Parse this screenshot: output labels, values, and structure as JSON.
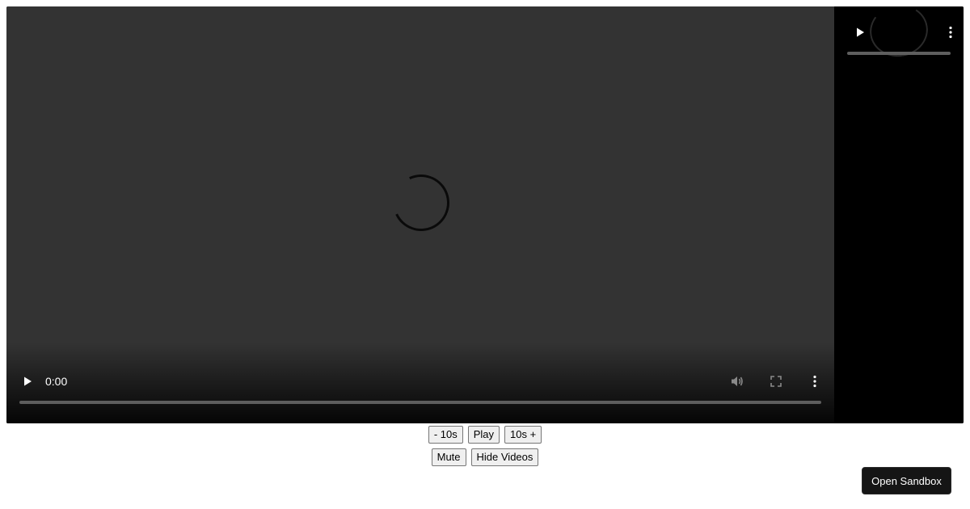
{
  "main_player": {
    "time": "0:00",
    "icons": {
      "play": "play-icon",
      "volume": "volume-icon",
      "fullscreen": "fullscreen-icon",
      "menu": "more-vertical-icon",
      "loading": "loading-spinner-icon"
    }
  },
  "side_player": {
    "icons": {
      "play": "play-icon",
      "menu": "more-vertical-icon",
      "loading": "loading-spinner-icon"
    }
  },
  "controls": {
    "rewind_label": "- 10s",
    "play_label": "Play",
    "forward_label": "10s +",
    "mute_label": "Mute",
    "hide_videos_label": "Hide Videos"
  },
  "sandbox": {
    "open_label": "Open Sandbox"
  },
  "colors": {
    "video_background": "#333333",
    "side_background": "#000000",
    "button_background": "#efefef",
    "sandbox_button": "#151515"
  }
}
